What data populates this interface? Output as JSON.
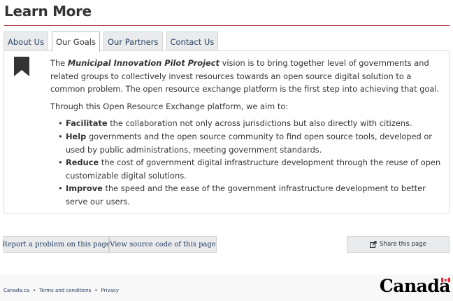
{
  "header": {
    "title": "Learn More"
  },
  "tabs": [
    {
      "label": "About Us",
      "active": false
    },
    {
      "label": "Our Goals",
      "active": true
    },
    {
      "label": "Our Partners",
      "active": false
    },
    {
      "label": "Contact Us",
      "active": false
    }
  ],
  "panel": {
    "intro_prefix": "The ",
    "intro_project": "Municipal Innovation Pilot Project",
    "intro_rest": " vision is to bring together level of governments and related groups to collectively invest resources towards an open source digital solution to a common problem. The open resource exchange platform is the first step into achieving that goal.",
    "aim_text": "Through this Open Resource Exchange platform, we aim to:",
    "goals": [
      {
        "bold": "Facilitate",
        "text": " the collaboration not only across jurisdictions but also directly with citizens."
      },
      {
        "bold": "Help",
        "text": " governments and the open source community to find open source tools, developed or used by public administrations, meeting government standards."
      },
      {
        "bold": "Reduce",
        "text": " the cost of government digital infrastructure development through the reuse of open customizable digital solutions."
      },
      {
        "bold": "Improve",
        "text": " the speed and the ease of the government infrastructure development to better serve our users."
      }
    ]
  },
  "actions": {
    "report_label": "Report a problem on this page",
    "source_label": "View source code of this page",
    "share_label": "Share this page"
  },
  "footer": {
    "links": [
      "Canada.ca",
      "Terms and conditions",
      "Privacy"
    ],
    "separator": "•",
    "wordmark": "Canada"
  },
  "icons": {
    "bookmark": "bookmark-icon",
    "share": "share-icon",
    "flag": "canada-flag-icon"
  },
  "colors": {
    "accent_rule": "#af3c43",
    "link": "#284162",
    "tab_bg": "#eaebed",
    "flag_red": "#eb2d37"
  }
}
